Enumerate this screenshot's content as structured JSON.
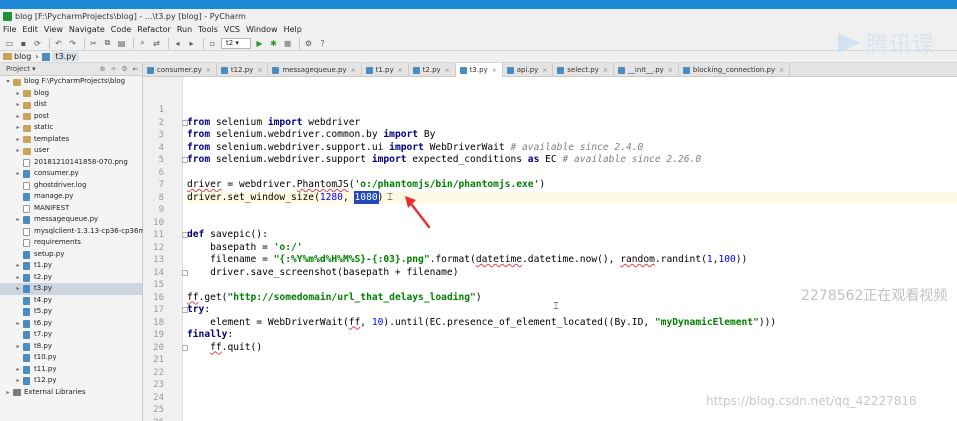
{
  "window": {
    "title": "blog [F:\\PycharmProjects\\blog] - ...\\t3.py [blog] - PyCharm"
  },
  "menu": [
    "File",
    "Edit",
    "View",
    "Navigate",
    "Code",
    "Refactor",
    "Run",
    "Tools",
    "VCS",
    "Window",
    "Help"
  ],
  "toolbar": {
    "run_config": "t2",
    "icons": [
      "open-folder-icon",
      "save-icon",
      "sync-icon",
      "undo-icon",
      "redo-icon",
      "cut-icon",
      "copy-icon",
      "paste-icon",
      "find-icon",
      "replace-icon",
      "back-icon",
      "forward-icon",
      "run-icon",
      "debug-icon",
      "stop-icon",
      "settings-icon",
      "help-icon"
    ]
  },
  "breadcrumb": [
    "blog",
    "t3.py"
  ],
  "project_panel": {
    "title": "Project",
    "tree": [
      {
        "label": "blog  F:\\PycharmProjects\\blog",
        "depth": 0,
        "type": "folder",
        "expanded": true
      },
      {
        "label": "blog",
        "depth": 1,
        "type": "folder",
        "expanded": false
      },
      {
        "label": "dist",
        "depth": 1,
        "type": "folder",
        "expanded": false
      },
      {
        "label": "post",
        "depth": 1,
        "type": "folder",
        "expanded": false
      },
      {
        "label": "static",
        "depth": 1,
        "type": "folder",
        "expanded": false
      },
      {
        "label": "templates",
        "depth": 1,
        "type": "folder",
        "expanded": false
      },
      {
        "label": "user",
        "depth": 1,
        "type": "folder",
        "expanded": false
      },
      {
        "label": "20181210141858-070.png",
        "depth": 1,
        "type": "file"
      },
      {
        "label": "consumer.py",
        "depth": 1,
        "type": "py",
        "expandable": true
      },
      {
        "label": "ghostdriver.log",
        "depth": 1,
        "type": "file"
      },
      {
        "label": "manage.py",
        "depth": 1,
        "type": "py"
      },
      {
        "label": "MANIFEST",
        "depth": 1,
        "type": "file"
      },
      {
        "label": "messagequeue.py",
        "depth": 1,
        "type": "py",
        "expandable": true
      },
      {
        "label": "mysqlclient-1.3.13-cp36-cp36m-w",
        "depth": 1,
        "type": "file"
      },
      {
        "label": "requirements",
        "depth": 1,
        "type": "file"
      },
      {
        "label": "setup.py",
        "depth": 1,
        "type": "py"
      },
      {
        "label": "t1.py",
        "depth": 1,
        "type": "py",
        "expandable": true
      },
      {
        "label": "t2.py",
        "depth": 1,
        "type": "py",
        "expandable": true
      },
      {
        "label": "t3.py",
        "depth": 1,
        "type": "py",
        "expandable": true,
        "selected": true
      },
      {
        "label": "t4.py",
        "depth": 1,
        "type": "py"
      },
      {
        "label": "t5.py",
        "depth": 1,
        "type": "py"
      },
      {
        "label": "t6.py",
        "depth": 1,
        "type": "py",
        "expandable": true
      },
      {
        "label": "t7.py",
        "depth": 1,
        "type": "py"
      },
      {
        "label": "t8.py",
        "depth": 1,
        "type": "py",
        "expandable": true
      },
      {
        "label": "t10.py",
        "depth": 1,
        "type": "py"
      },
      {
        "label": "t11.py",
        "depth": 1,
        "type": "py",
        "expandable": true
      },
      {
        "label": "t12.py",
        "depth": 1,
        "type": "py",
        "expandable": true
      },
      {
        "label": "External Libraries",
        "depth": 0,
        "type": "lib",
        "expanded": false
      }
    ]
  },
  "tabs": [
    {
      "label": "consumer.py",
      "active": false
    },
    {
      "label": "t12.py",
      "active": false
    },
    {
      "label": "messagequeue.py",
      "active": false
    },
    {
      "label": "t1.py",
      "active": false
    },
    {
      "label": "t2.py",
      "active": false
    },
    {
      "label": "t3.py",
      "active": true
    },
    {
      "label": "api.py",
      "active": false
    },
    {
      "label": "select.py",
      "active": false
    },
    {
      "label": "__init__.py",
      "active": false
    },
    {
      "label": "blocking_connection.py",
      "active": false
    }
  ],
  "editor": {
    "line_numbers": [
      "1",
      "2",
      "3",
      "4",
      "5",
      "6",
      "7",
      "8",
      "9",
      "10",
      "11",
      "12",
      "13",
      "14",
      "15",
      "16",
      "17",
      "18",
      "19",
      "20",
      "21",
      "22",
      "23",
      "24",
      "25",
      "26"
    ],
    "current_line": 8,
    "selection": "1080",
    "code": {
      "l2_kw1": "from",
      "l2_mod": " selenium ",
      "l2_kw2": "import",
      "l2_rest": " webdriver",
      "l3_kw1": "from",
      "l3_mod": " selenium.webdriver.common.by ",
      "l3_kw2": "import",
      "l3_rest": " By",
      "l4_kw1": "from",
      "l4_mod": " selenium.webdriver.support.ui ",
      "l4_kw2": "import",
      "l4_rest": " WebDriverWait ",
      "l4_cm": "# available since 2.4.0",
      "l5_kw1": "from",
      "l5_mod": " selenium.webdriver.support ",
      "l5_kw2": "import",
      "l5_rest": " expected_conditions ",
      "l5_kw3": "as",
      "l5_rest2": " EC ",
      "l5_cm": "# available since 2.26.0",
      "l7_a": "driver",
      "l7_b": " = webdriver.",
      "l7_c": "PhantomJS",
      "l7_d": "(",
      "l7_str": "'o:/phantomjs/bin/phantomjs.exe'",
      "l7_e": ")",
      "l8_a": "driver.set_window_size(",
      "l8_n1": "1280",
      "l8_b": ", ",
      "l8_sel": "1080",
      "l8_c": ")",
      "l11_kw": "def",
      "l11_rest": " savepic():",
      "l12_a": "    basepath = ",
      "l12_str": "'o:/'",
      "l13_a": "    filename = ",
      "l13_str": "\"{:%Y%m%d%H%M%S}-{:03}.png\"",
      "l13_b": ".format(",
      "l13_sq1": "datetime",
      "l13_c": ".datetime.now(), ",
      "l13_sq2": "random",
      "l13_d": ".randint(",
      "l13_n1": "1",
      "l13_e": ",",
      "l13_n2": "100",
      "l13_f": "))",
      "l14_a": "    driver.save_screenshot(basepath + filename)",
      "l16_a": "ff",
      "l16_b": ".get(",
      "l16_str": "\"http://somedomain/url_that_delays_loading\"",
      "l16_c": ")",
      "l17_kw": "try",
      "l17_rest": ":",
      "l18_a": "    element = WebDriverWait(",
      "l18_sq1": "ff",
      "l18_b": ", ",
      "l18_n1": "10",
      "l18_c": ").until(EC.presence_of_element_located((By.ID, ",
      "l18_str": "\"myDynamicElement\"",
      "l18_d": ")))",
      "l19_kw": "finally",
      "l19_rest": ":",
      "l20_a": "    ",
      "l20_sq": "ff",
      "l20_b": ".quit()"
    }
  },
  "overlay": {
    "brand": "腾讯课",
    "viewers": "2278562正在观看视频",
    "url": "https://blog.csdn.net/qq_42227818",
    "arrow_color": "#e03030"
  }
}
